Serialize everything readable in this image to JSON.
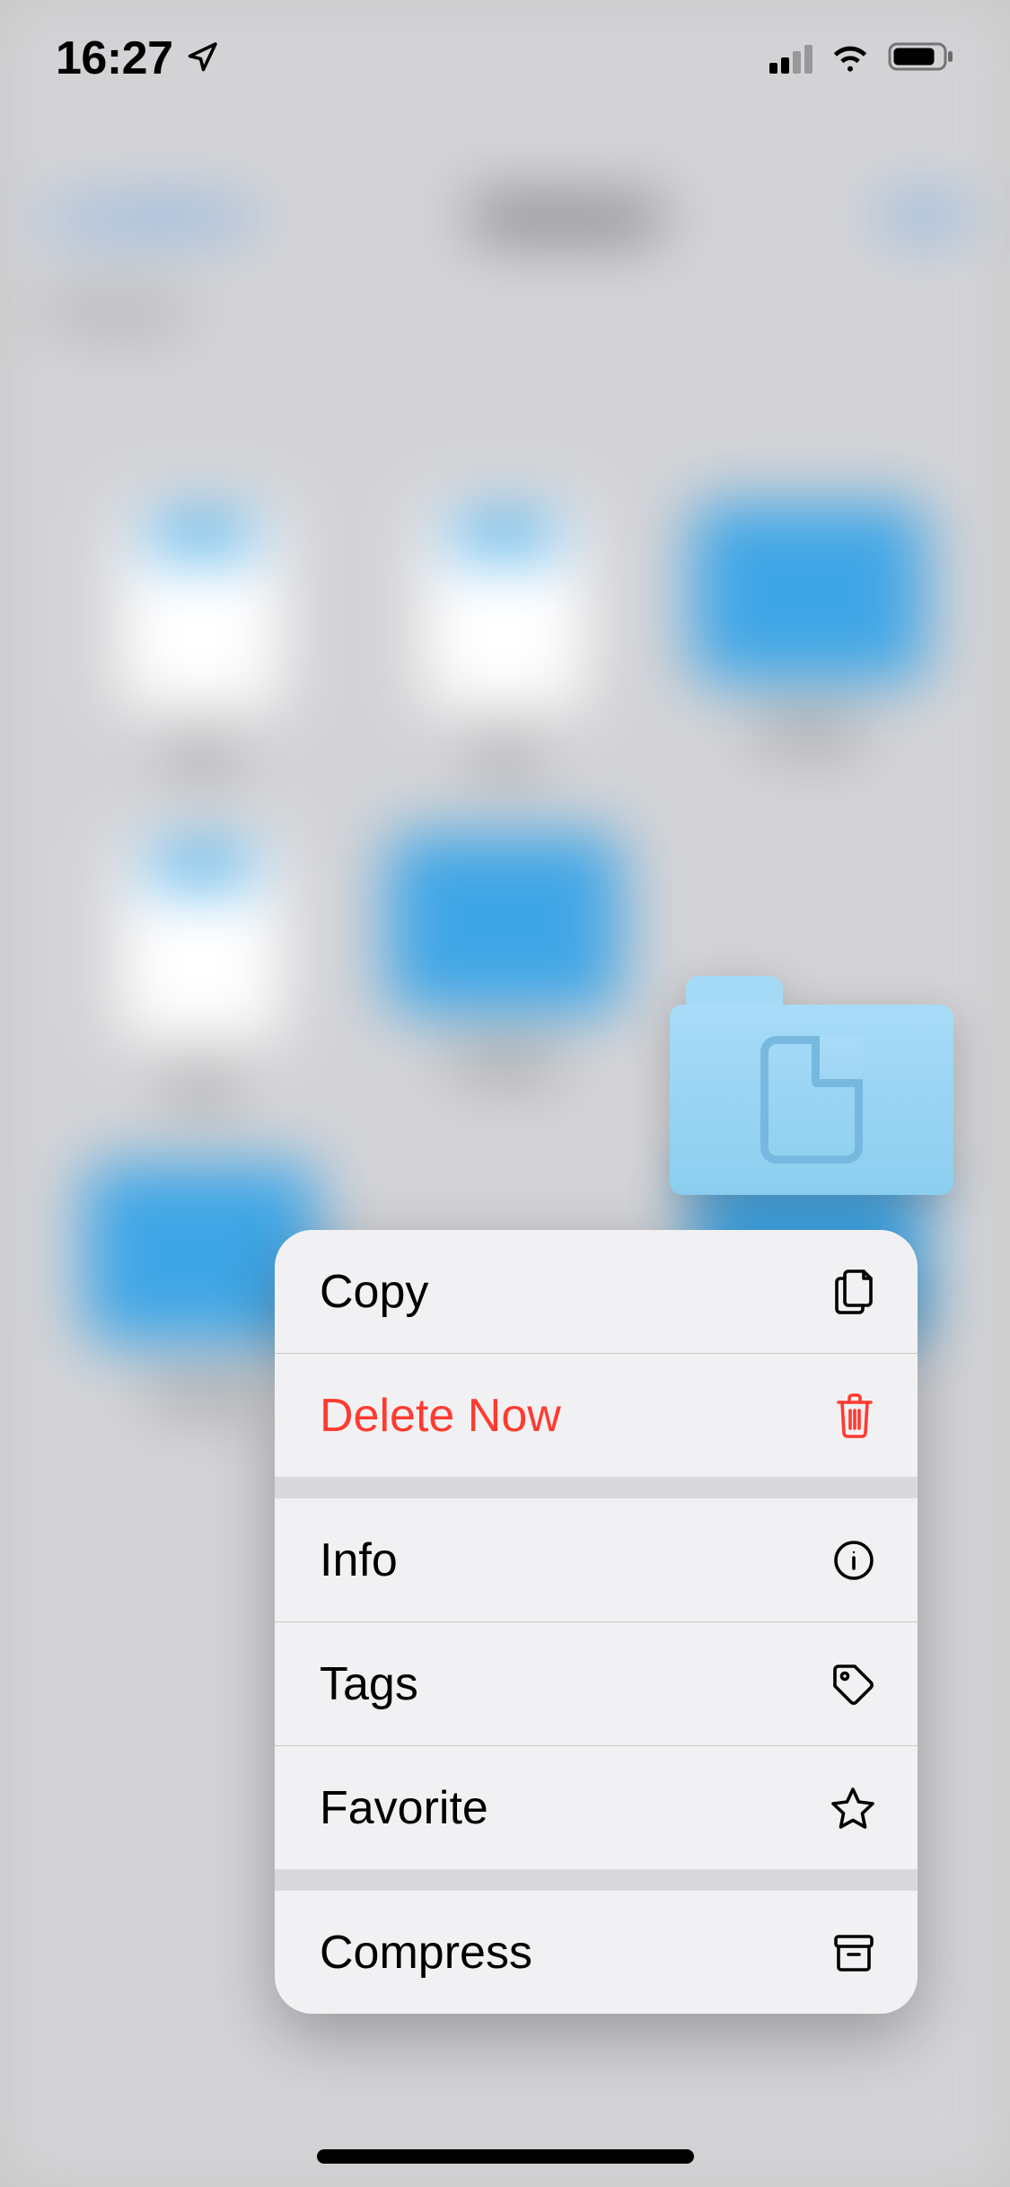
{
  "status_bar": {
    "time": "16:27",
    "location_active": true,
    "cellular_bars_active": 2,
    "cellular_bars_total": 4,
    "wifi_active": true,
    "battery_level_percent": 80
  },
  "preview": {
    "item_type": "folder-documents"
  },
  "context_menu": {
    "groups": [
      [
        {
          "id": "copy",
          "label": "Copy",
          "icon": "doc-on-doc",
          "destructive": false
        },
        {
          "id": "delete-now",
          "label": "Delete Now",
          "icon": "trash",
          "destructive": true
        }
      ],
      [
        {
          "id": "info",
          "label": "Info",
          "icon": "info-circle",
          "destructive": false
        },
        {
          "id": "tags",
          "label": "Tags",
          "icon": "tag",
          "destructive": false
        },
        {
          "id": "favorite",
          "label": "Favorite",
          "icon": "star",
          "destructive": false
        }
      ],
      [
        {
          "id": "compress",
          "label": "Compress",
          "icon": "archivebox",
          "destructive": false
        }
      ]
    ]
  },
  "colors": {
    "accent": "#007aff",
    "destructive": "#ff3b30",
    "folder_light": "#a8dbf7",
    "folder_dark": "#8cceef",
    "folder_stroke": "#77b9de"
  }
}
